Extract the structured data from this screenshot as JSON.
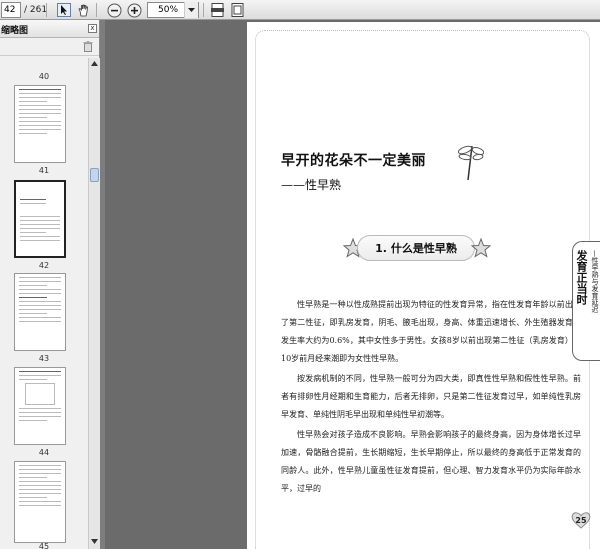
{
  "toolbar": {
    "current_page": "42",
    "total_pages": "/ 261",
    "zoom": "50%",
    "icons": [
      "select-cursor-icon",
      "hand-tool-icon",
      "zoom-out-icon",
      "zoom-in-icon",
      "fit-width-icon",
      "fit-page-icon"
    ]
  },
  "sidebar": {
    "title": "缩略图",
    "close_label": "x",
    "thumbnails": [
      {
        "label": "40"
      },
      {
        "label": "41"
      },
      {
        "label": "42",
        "selected": true
      },
      {
        "label": "43"
      },
      {
        "label": "44"
      },
      {
        "label": "45"
      }
    ]
  },
  "document": {
    "chapter_title": "早开的花朵不一定美丽",
    "chapter_subtitle": "——性早熟",
    "section_title": "1. 什么是性早熟",
    "side_tab_main": "发育正当时",
    "side_tab_sub": "—性早熟与发育延迟",
    "page_number": "25",
    "paragraphs": [
      "性早熟是一种以性成熟提前出现为特征的性发育异常，指在性发育年龄以前出现了第二性征，即乳房发育，阴毛、腋毛出现，身高、体重迅速增长、外生殖器发育，发生率大约为0.6%，其中女性多于男性。女孩8岁以前出现第二性征（乳房发育）或10岁前月经来潮即为女性性早熟。",
      "按发病机制的不同，性早熟一般可分为四大类，即真性性早熟和假性性早熟。前者有排卵性月经期和生育能力，后者无排卵，只是第二性征发育过早，如单纯性乳房早发育、单纯性阴毛早出现和单纯性早初潮等。",
      "性早熟会对孩子造成不良影响。早熟会影响孩子的最终身高，因为身体增长过早加速，骨骼融合提前，生长期缩短，生长早期停止，所以最终的身高低于正常发育的同龄人。此外，性早熟儿童虽性征发育提前，但心理、智力发育水平仍为实际年龄水平，过早的"
    ]
  }
}
